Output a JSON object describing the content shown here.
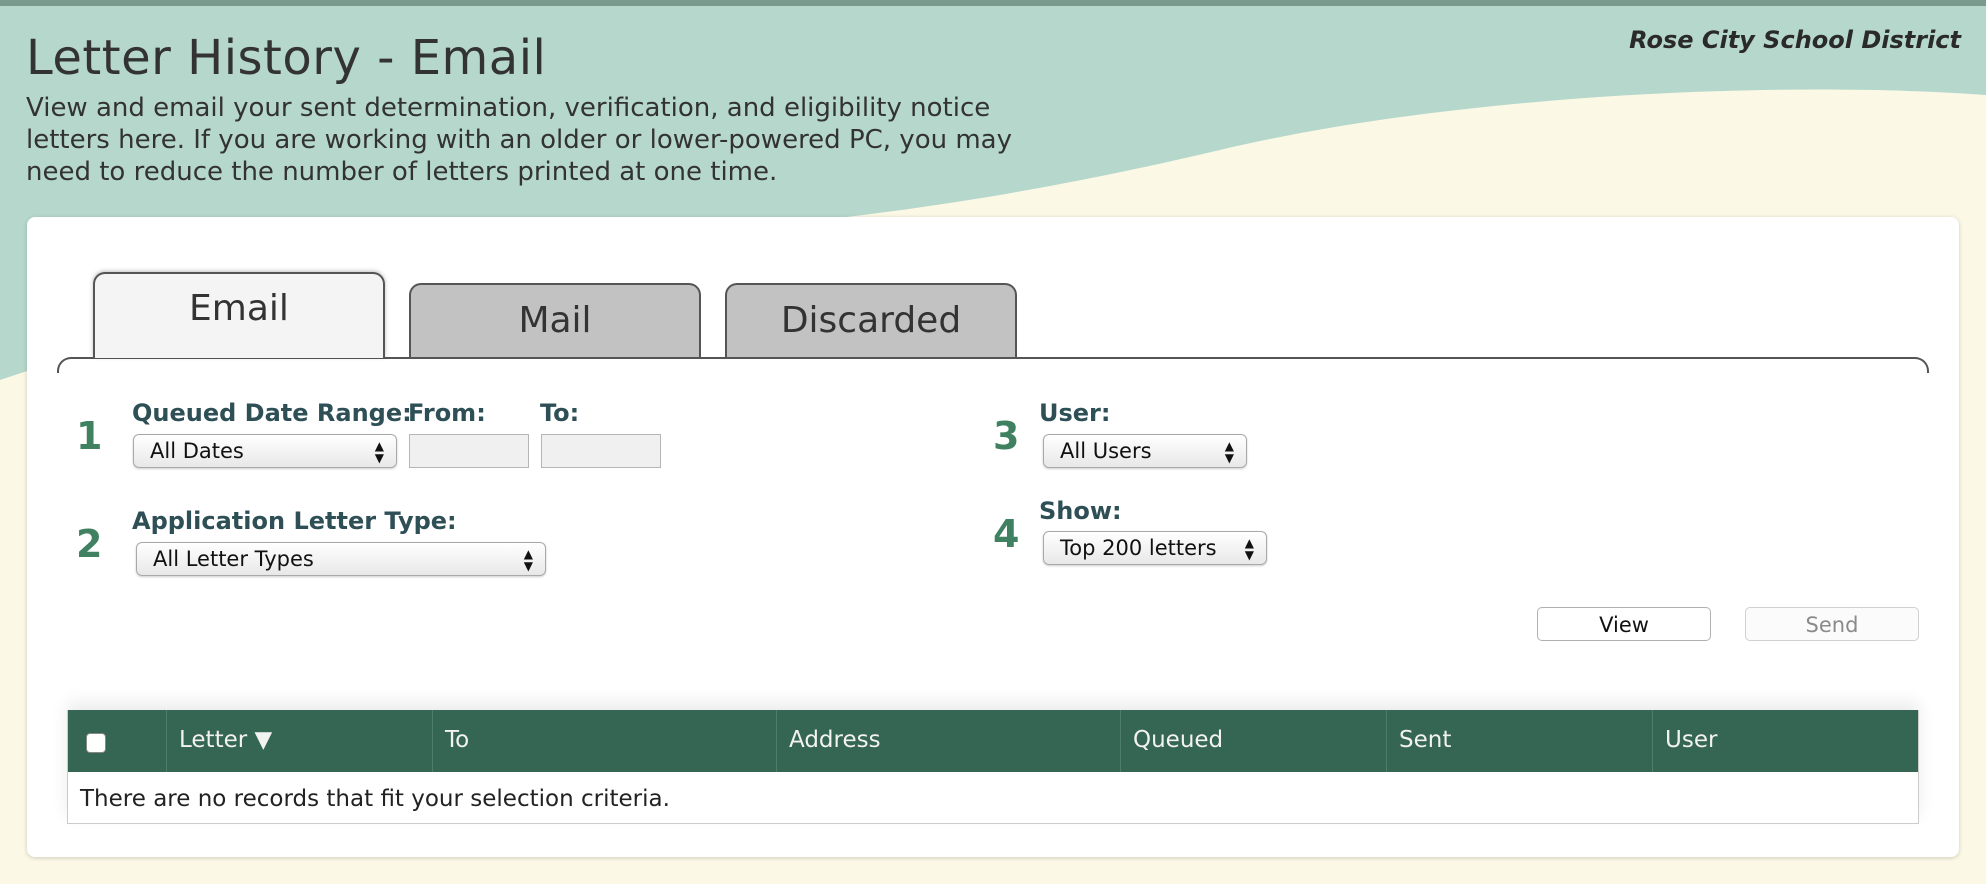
{
  "header": {
    "district": "Rose City School District",
    "title": "Letter History - Email",
    "description": "View and email your sent determination, verification, and eligibility notice letters here. If you are working with an older or lower-powered PC, you may need to reduce the number of letters printed at one time."
  },
  "tabs": [
    {
      "label": "Email",
      "active": true
    },
    {
      "label": "Mail",
      "active": false
    },
    {
      "label": "Discarded",
      "active": false
    }
  ],
  "filters": {
    "step1": {
      "number": "1",
      "label": "Queued Date Range:",
      "value": "All Dates",
      "from_label": "From:",
      "to_label": "To:",
      "from_value": "",
      "to_value": ""
    },
    "step2": {
      "number": "2",
      "label": "Application Letter Type:",
      "value": "All Letter Types"
    },
    "step3": {
      "number": "3",
      "label": "User:",
      "value": "All Users"
    },
    "step4": {
      "number": "4",
      "label": "Show:",
      "value": "Top 200 letters"
    }
  },
  "actions": {
    "view_label": "View",
    "send_label": "Send"
  },
  "table": {
    "columns": [
      "Letter ▼",
      "To",
      "Address",
      "Queued",
      "Sent",
      "User"
    ],
    "empty_message": "There are no records that fit your selection criteria."
  },
  "colors": {
    "accent_green": "#356553",
    "step_number_green": "#3f8160",
    "label_teal": "#2d4f55",
    "background_mint": "#b6d8cc",
    "background_cream": "#fcf8e6"
  },
  "icons": {
    "select_arrows": "updown-arrows-icon",
    "sort_indicator": "sort-desc-icon"
  }
}
